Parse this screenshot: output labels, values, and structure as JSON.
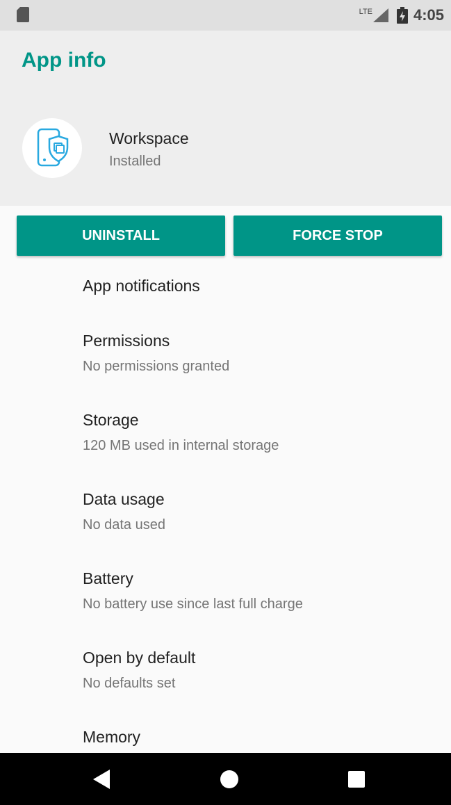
{
  "status_bar": {
    "network": "LTE",
    "time": "4:05"
  },
  "header": {
    "title": "App info",
    "app_name": "Workspace",
    "app_status": "Installed",
    "accent_color": "#009587"
  },
  "buttons": {
    "uninstall": "UNINSTALL",
    "force_stop": "FORCE STOP"
  },
  "settings": [
    {
      "title": "App notifications",
      "subtitle": ""
    },
    {
      "title": "Permissions",
      "subtitle": "No permissions granted"
    },
    {
      "title": "Storage",
      "subtitle": "120 MB used in internal storage"
    },
    {
      "title": "Data usage",
      "subtitle": "No data used"
    },
    {
      "title": "Battery",
      "subtitle": "No battery use since last full charge"
    },
    {
      "title": "Open by default",
      "subtitle": "No defaults set"
    },
    {
      "title": "Memory",
      "subtitle": ""
    }
  ],
  "nav_bar": {
    "icons": [
      "back-icon",
      "home-icon",
      "recents-icon"
    ]
  }
}
